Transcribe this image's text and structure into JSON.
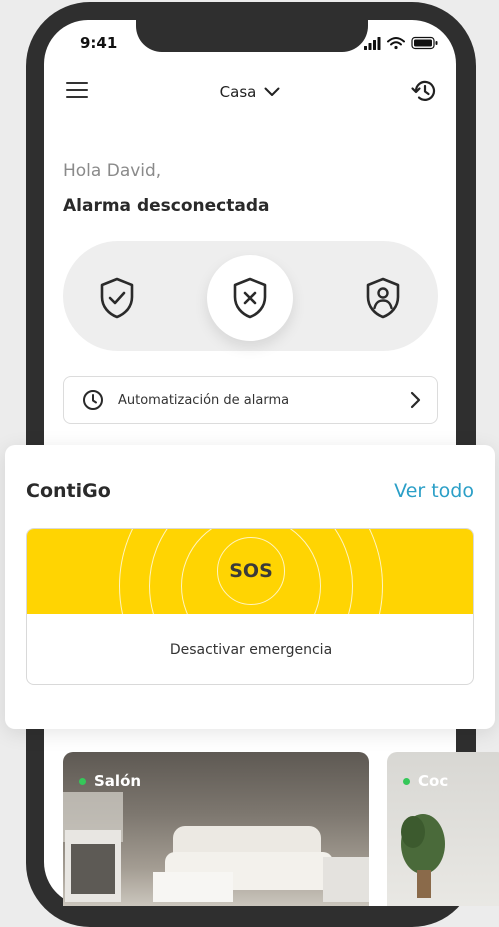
{
  "status_bar": {
    "time": "9:41"
  },
  "header": {
    "location": "Casa"
  },
  "greeting": "Hola David,",
  "alarm_status": "Alarma desconectada",
  "modes": [
    {
      "icon": "shield-check-icon"
    },
    {
      "icon": "shield-x-icon",
      "active": true
    },
    {
      "icon": "shield-person-icon"
    }
  ],
  "automation": {
    "label": "Automatización de alarma"
  },
  "contigo": {
    "title": "ContiGo",
    "see_all": "Ver todo",
    "sos_label": "SOS",
    "deactivate": "Desactivar emergencia"
  },
  "rooms": [
    {
      "name": "Salón",
      "online": true
    },
    {
      "name": "Coc",
      "online": true
    }
  ],
  "colors": {
    "accent_yellow": "#ffd402",
    "link_blue": "#2b9fc7",
    "online_green": "#35c759",
    "phone_frame": "#2f2f2f"
  }
}
